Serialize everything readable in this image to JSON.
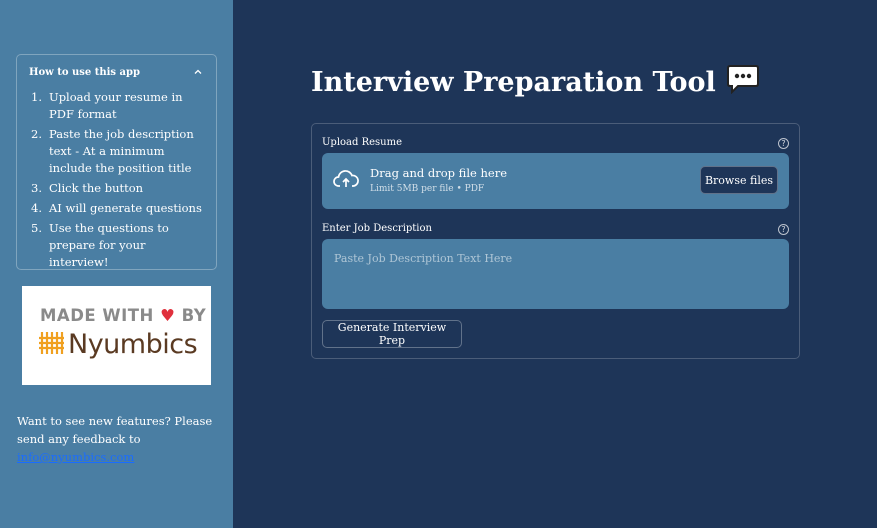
{
  "sidebar": {
    "expander": {
      "title": "How to use this app",
      "steps": [
        {
          "num": "1.",
          "text": "Upload your resume in PDF format"
        },
        {
          "num": "2.",
          "text": "Paste the job description text - At a minimum include the position title"
        },
        {
          "num": "3.",
          "text": "Click the button"
        },
        {
          "num": "4.",
          "text": "AI will generate questions"
        },
        {
          "num": "5.",
          "text": "Use the questions to prepare for your interview!"
        }
      ]
    },
    "badge": {
      "made_with": "MADE WITH",
      "by": "BY",
      "brand": "Nyumbics"
    },
    "feedback": {
      "text": "Want to see new features? Please send any feedback to ",
      "email": "info@nyumbics.com"
    }
  },
  "main": {
    "title": "Interview Preparation Tool",
    "upload": {
      "label": "Upload Resume",
      "drop_title": "Drag and drop file here",
      "drop_limit": "Limit 5MB per file • PDF",
      "browse_label": "Browse files"
    },
    "job": {
      "label": "Enter Job Description",
      "placeholder": "Paste Job Description Text Here"
    },
    "generate_label": "Generate Interview Prep"
  },
  "colors": {
    "main_bg": "#1e3558",
    "sidebar_bg": "#4a7ea3",
    "link": "#1a6cff",
    "heart": "#e0303c"
  },
  "icons": [
    "chevron-up-icon",
    "help-icon",
    "cloud-upload-icon",
    "speech-bubble-icon",
    "heart-icon",
    "nyumbics-logo-icon"
  ]
}
